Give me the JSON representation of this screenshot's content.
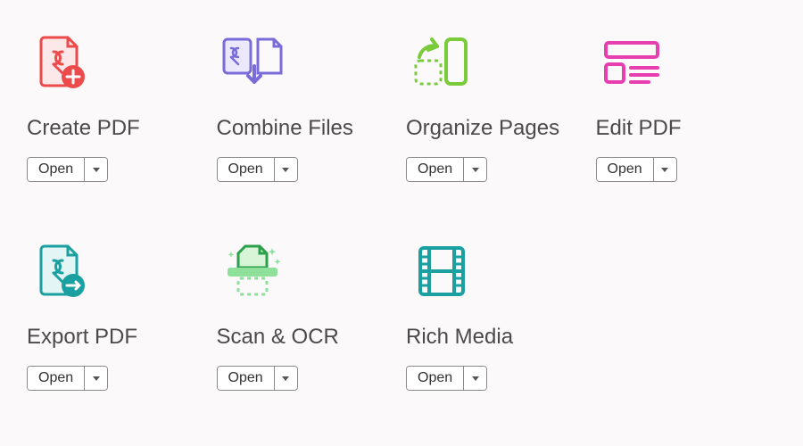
{
  "button_label": "Open",
  "tools": [
    {
      "id": "create-pdf",
      "title": "Create PDF"
    },
    {
      "id": "combine-files",
      "title": "Combine Files"
    },
    {
      "id": "organize-pages",
      "title": "Organize Pages"
    },
    {
      "id": "edit-pdf",
      "title": "Edit PDF"
    },
    {
      "id": "export-pdf",
      "title": "Export PDF"
    },
    {
      "id": "scan-ocr",
      "title": "Scan & OCR"
    },
    {
      "id": "rich-media",
      "title": "Rich Media"
    }
  ],
  "colors": {
    "create": "#ed4b4b",
    "combine": "#7a6cd8",
    "organize": "#7acb3a",
    "edit": "#e83fb0",
    "export": "#1aa0a0",
    "scan_dark": "#2aa04a",
    "scan_light": "#8fe09a",
    "media": "#1aa0a0"
  }
}
